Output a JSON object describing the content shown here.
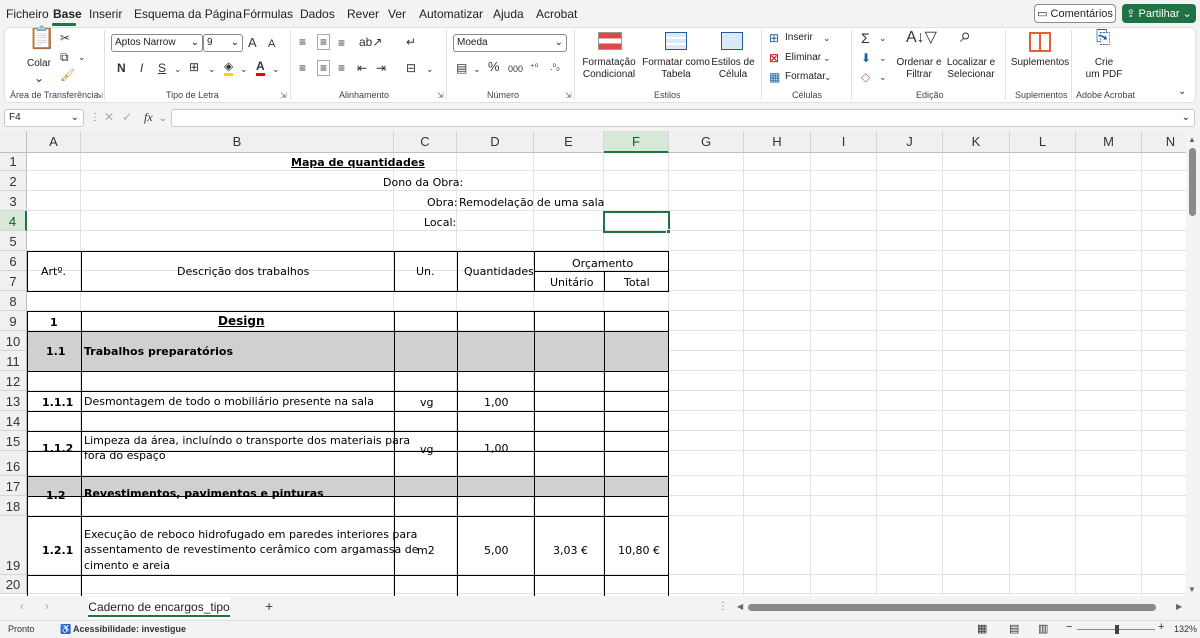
{
  "menu": {
    "items": [
      "Ficheiro",
      "Base",
      "Inserir",
      "Esquema da Página",
      "Fórmulas",
      "Dados",
      "Rever",
      "Ver",
      "Automatizar",
      "Ajuda",
      "Acrobat"
    ],
    "active": "Base",
    "comments_label": "Comentários",
    "share_label": "Partilhar"
  },
  "ribbon": {
    "clipboard": {
      "paste": "Colar",
      "group": "Área de Transferência"
    },
    "font": {
      "name": "Aptos Narrow",
      "size": "9",
      "bold": "N",
      "italic": "I",
      "underline": "S",
      "grow": "A",
      "shrink": "A",
      "group": "Tipo de Letra"
    },
    "alignment": {
      "group": "Alinhamento"
    },
    "number": {
      "format": "Moeda",
      "percent": "%",
      "thousands": "000",
      "group": "Número"
    },
    "styles": {
      "conditional": "Formatação\nCondicional",
      "table": "Formatar como\nTabela",
      "cell": "Estilos de\nCélula",
      "group": "Estilos"
    },
    "cells": {
      "insert": "Inserir",
      "delete": "Eliminar",
      "format": "Formatar",
      "group": "Células"
    },
    "editing": {
      "sort": "Ordenar e\nFiltrar",
      "find": "Localizar e\nSelecionar",
      "group": "Edição"
    },
    "addins": {
      "label": "Suplementos",
      "group": "Suplementos"
    },
    "acrobat": {
      "label": "Crie\num PDF",
      "group": "Adobe Acrobat"
    }
  },
  "formula_bar": {
    "name_box": "F4",
    "fx": "fx",
    "content": ""
  },
  "columns": [
    "A",
    "B",
    "C",
    "D",
    "E",
    "F",
    "G",
    "H",
    "I",
    "J",
    "K",
    "L",
    "M",
    "N"
  ],
  "rows": [
    "1",
    "2",
    "3",
    "4",
    "5",
    "6",
    "7",
    "8",
    "9",
    "10",
    "11",
    "12",
    "13",
    "14",
    "15",
    "16",
    "17",
    "18",
    "19",
    "20"
  ],
  "selected_cell": {
    "col": "F",
    "row": "4"
  },
  "sheet": {
    "title": "Mapa de quantidades",
    "owner_label": "Dono da Obra:",
    "work_label": "Obra:",
    "work_value": "Remodelação de uma sala",
    "location_label": "Local:",
    "headers": {
      "art": "Artº.",
      "desc": "Descrição dos trabalhos",
      "unit": "Un.",
      "qty": "Quantidades",
      "budget": "Orçamento",
      "unit_price": "Unitário",
      "total": "Total"
    },
    "items": [
      {
        "art": "1",
        "desc": "Design"
      },
      {
        "art": "1.1",
        "desc": "Trabalhos preparatórios"
      },
      {
        "art": "1.1.1",
        "desc": "Desmontagem de todo o mobiliário presente na sala",
        "unit": "vg",
        "qty": "1,00"
      },
      {
        "art": "1.1.2",
        "desc_lines": [
          "Limpeza da área, incluíndo o transporte dos materiais para",
          "fora do espaço"
        ],
        "unit": "vg",
        "qty": "1,00"
      },
      {
        "art": "1.2",
        "desc": "Revestimentos, pavimentos e pinturas"
      },
      {
        "art": "1.2.1",
        "desc_lines": [
          "Execução de reboco hidrofugado em paredes interiores para",
          "assentamento de revestimento cerâmico com argamassa de",
          "cimento e areia"
        ],
        "unit": "m2",
        "qty": "5,00",
        "unit_price": "3,03 €",
        "total": "10,80 €"
      }
    ]
  },
  "sheet_tab": "Caderno de encargos_tipo",
  "status": {
    "ready": "Pronto",
    "accessibility": "Acessibilidade: investigue",
    "zoom": "132%"
  }
}
